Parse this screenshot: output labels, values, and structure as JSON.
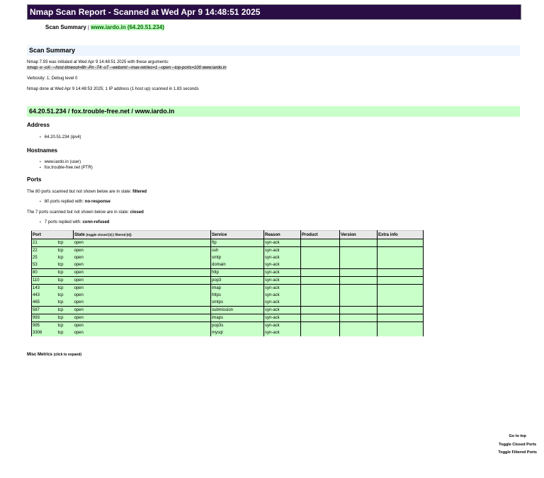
{
  "title": "Nmap Scan Report - Scanned at Wed Apr 9 14:48:51 2025",
  "nav": {
    "summary": "Scan Summary",
    "sep": "|",
    "host": "www.iardo.in (64.20.51.234)"
  },
  "summary": {
    "heading": "Scan Summary",
    "initiated": "Nmap 7.93 was initiated at Wed Apr 9 14:48:51 2025 with these arguments:",
    "command": "nmap -v -oX- --host-timeout=8h -Pn -T4 -sT --webxml --max-retries=1 --open --top-ports=100 www.iardo.in",
    "verbosity": "Verbosity: 1; Debug level 0",
    "done": "Nmap done at Wed Apr 9 14:48:53 2025; 1 IP address (1 host up) scanned in 1.83 seconds"
  },
  "host": {
    "heading": "64.20.51.234 / fox.trouble-free.net / www.iardo.in",
    "address_label": "Address",
    "addresses": [
      "64.20.51.234 (ipv4)"
    ],
    "hostnames_label": "Hostnames",
    "hostnames": [
      "www.iardo.in (user)",
      "fox.trouble-free.net (PTR)"
    ],
    "ports_label": "Ports",
    "filtered_text": "The 80 ports scanned but not shown below are in state: ",
    "filtered_state": "filtered",
    "filtered_reason_text": "80 ports replied with: ",
    "filtered_reason": "no-response",
    "closed_text": "The 7 ports scanned but not shown below are in state: ",
    "closed_state": "closed",
    "closed_reason_text": "7 ports replied with: ",
    "closed_reason": "conn-refused"
  },
  "table": {
    "headers": {
      "port": "Port",
      "state": "State",
      "toggle": "(toggle closed [0] | filtered [0])",
      "service": "Service",
      "reason": "Reason",
      "product": "Product",
      "version": "Version",
      "extra": "Extra info"
    },
    "rows": [
      {
        "port": "21",
        "proto": "tcp",
        "state": "open",
        "service": "ftp",
        "reason": "syn-ack",
        "group_start": true
      },
      {
        "port": "22",
        "proto": "tcp",
        "state": "open",
        "service": "ssh",
        "reason": "syn-ack",
        "group_start": true
      },
      {
        "port": "25",
        "proto": "tcp",
        "state": "open",
        "service": "smtp",
        "reason": "syn-ack",
        "group_start": false
      },
      {
        "port": "53",
        "proto": "tcp",
        "state": "open",
        "service": "domain",
        "reason": "syn-ack",
        "group_start": false
      },
      {
        "port": "80",
        "proto": "tcp",
        "state": "open",
        "service": "http",
        "reason": "syn-ack",
        "group_start": true
      },
      {
        "port": "110",
        "proto": "tcp",
        "state": "open",
        "service": "pop3",
        "reason": "syn-ack",
        "group_start": true
      },
      {
        "port": "143",
        "proto": "tcp",
        "state": "open",
        "service": "imap",
        "reason": "syn-ack",
        "group_start": true
      },
      {
        "port": "443",
        "proto": "tcp",
        "state": "open",
        "service": "https",
        "reason": "syn-ack",
        "group_start": false
      },
      {
        "port": "465",
        "proto": "tcp",
        "state": "open",
        "service": "smtps",
        "reason": "syn-ack",
        "group_start": false
      },
      {
        "port": "587",
        "proto": "tcp",
        "state": "open",
        "service": "submission",
        "reason": "syn-ack",
        "group_start": true
      },
      {
        "port": "993",
        "proto": "tcp",
        "state": "open",
        "service": "imaps",
        "reason": "syn-ack",
        "group_start": true
      },
      {
        "port": "995",
        "proto": "tcp",
        "state": "open",
        "service": "pop3s",
        "reason": "syn-ack",
        "group_start": true
      },
      {
        "port": "3306",
        "proto": "tcp",
        "state": "open",
        "service": "mysql",
        "reason": "syn-ack",
        "group_start": false
      }
    ]
  },
  "misc": {
    "label": "Misc Metrics",
    "hint": "(click to expand)"
  },
  "links": {
    "top": "Go to top",
    "closed": "Toggle Closed Ports",
    "filtered": "Toggle Filtered Ports"
  }
}
